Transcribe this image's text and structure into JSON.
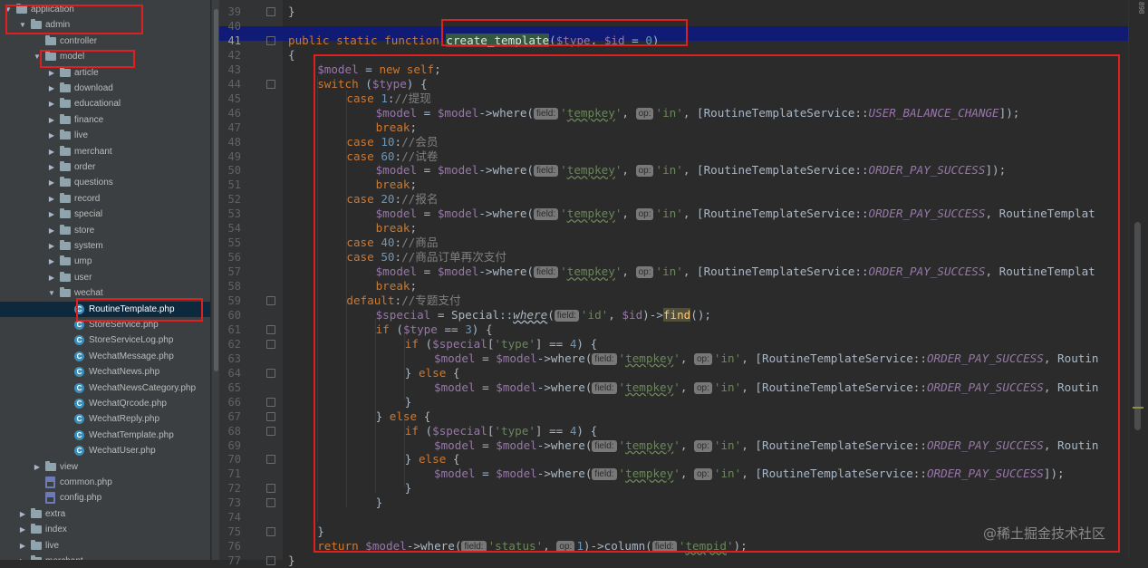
{
  "project_tree": {
    "items": [
      {
        "label": "application",
        "type": "folder",
        "depth": 0,
        "expanded": true
      },
      {
        "label": "admin",
        "type": "folder",
        "depth": 1,
        "expanded": true
      },
      {
        "label": "controller",
        "type": "folder",
        "depth": 2,
        "expanded": false,
        "no_arrow": true
      },
      {
        "label": "model",
        "type": "folder",
        "depth": 2,
        "expanded": true
      },
      {
        "label": "article",
        "type": "folder",
        "depth": 3,
        "expanded": false
      },
      {
        "label": "download",
        "type": "folder",
        "depth": 3,
        "expanded": false
      },
      {
        "label": "educational",
        "type": "folder",
        "depth": 3,
        "expanded": false
      },
      {
        "label": "finance",
        "type": "folder",
        "depth": 3,
        "expanded": false
      },
      {
        "label": "live",
        "type": "folder",
        "depth": 3,
        "expanded": false
      },
      {
        "label": "merchant",
        "type": "folder",
        "depth": 3,
        "expanded": false
      },
      {
        "label": "order",
        "type": "folder",
        "depth": 3,
        "expanded": false
      },
      {
        "label": "questions",
        "type": "folder",
        "depth": 3,
        "expanded": false
      },
      {
        "label": "record",
        "type": "folder",
        "depth": 3,
        "expanded": false
      },
      {
        "label": "special",
        "type": "folder",
        "depth": 3,
        "expanded": false
      },
      {
        "label": "store",
        "type": "folder",
        "depth": 3,
        "expanded": false
      },
      {
        "label": "system",
        "type": "folder",
        "depth": 3,
        "expanded": false
      },
      {
        "label": "ump",
        "type": "folder",
        "depth": 3,
        "expanded": false
      },
      {
        "label": "user",
        "type": "folder",
        "depth": 3,
        "expanded": false
      },
      {
        "label": "wechat",
        "type": "folder",
        "depth": 3,
        "expanded": true
      },
      {
        "label": "RoutineTemplate.php",
        "type": "class",
        "depth": 4,
        "selected": true
      },
      {
        "label": "StoreService.php",
        "type": "class",
        "depth": 4
      },
      {
        "label": "StoreServiceLog.php",
        "type": "class",
        "depth": 4
      },
      {
        "label": "WechatMessage.php",
        "type": "class",
        "depth": 4
      },
      {
        "label": "WechatNews.php",
        "type": "class",
        "depth": 4
      },
      {
        "label": "WechatNewsCategory.php",
        "type": "class",
        "depth": 4
      },
      {
        "label": "WechatQrcode.php",
        "type": "class",
        "depth": 4
      },
      {
        "label": "WechatReply.php",
        "type": "class",
        "depth": 4
      },
      {
        "label": "WechatTemplate.php",
        "type": "class",
        "depth": 4
      },
      {
        "label": "WechatUser.php",
        "type": "class",
        "depth": 4
      },
      {
        "label": "view",
        "type": "folder",
        "depth": 2,
        "expanded": false
      },
      {
        "label": "common.php",
        "type": "php",
        "depth": 2
      },
      {
        "label": "config.php",
        "type": "php",
        "depth": 2
      },
      {
        "label": "extra",
        "type": "folder",
        "depth": 1,
        "expanded": false
      },
      {
        "label": "index",
        "type": "folder",
        "depth": 1,
        "expanded": false
      },
      {
        "label": "live",
        "type": "folder",
        "depth": 1,
        "expanded": false
      },
      {
        "label": "merchant",
        "type": "folder",
        "depth": 1,
        "expanded": false
      }
    ]
  },
  "editor": {
    "current_line": 41,
    "lines": [
      {
        "n": 39,
        "indent": 0,
        "html": "}"
      },
      {
        "n": 40,
        "indent": 0,
        "html": ""
      },
      {
        "n": 41,
        "indent": 0,
        "html": "<span class=\"kw\">public static function </span><span class=\"hl\">create_template</span>(<span class=\"var\">$type</span>, <span class=\"var\">$id</span> = <span class=\"num\">0</span>)"
      },
      {
        "n": 42,
        "indent": 0,
        "html": "{"
      },
      {
        "n": 43,
        "indent": 1,
        "html": "<span class=\"var\">$model</span> = <span class=\"kw\">new self</span>;"
      },
      {
        "n": 44,
        "indent": 1,
        "html": "<span class=\"kw\">switch </span>(<span class=\"var\">$type</span>) {"
      },
      {
        "n": 45,
        "indent": 2,
        "html": "<span class=\"kw\">case </span><span class=\"num\">1</span>:<span class=\"cmt\">//提现</span>"
      },
      {
        "n": 46,
        "indent": 3,
        "html": "<span class=\"var\">$model</span> = <span class=\"var\">$model</span>-&gt;where(<span class=\"hint\">field:</span><span class=\"str\">'<span class=\"sq\">tempkey</span>'</span>, <span class=\"hint\">op:</span><span class=\"str\">'in'</span>, [RoutineTemplateService::<span class=\"cn\">USER_BALANCE_CHANGE</span>]);"
      },
      {
        "n": 47,
        "indent": 3,
        "html": "<span class=\"kw\">break</span>;"
      },
      {
        "n": 48,
        "indent": 2,
        "html": "<span class=\"kw\">case </span><span class=\"num\">10</span>:<span class=\"cmt\">//会员</span>"
      },
      {
        "n": 49,
        "indent": 2,
        "html": "<span class=\"kw\">case </span><span class=\"num\">60</span>:<span class=\"cmt\">//试卷</span>"
      },
      {
        "n": 50,
        "indent": 3,
        "html": "<span class=\"var\">$model</span> = <span class=\"var\">$model</span>-&gt;where(<span class=\"hint\">field:</span><span class=\"str\">'<span class=\"sq\">tempkey</span>'</span>, <span class=\"hint\">op:</span><span class=\"str\">'in'</span>, [RoutineTemplateService::<span class=\"cn\">ORDER_PAY_SUCCESS</span>]);"
      },
      {
        "n": 51,
        "indent": 3,
        "html": "<span class=\"kw\">break</span>;"
      },
      {
        "n": 52,
        "indent": 2,
        "html": "<span class=\"kw\">case </span><span class=\"num\">20</span>:<span class=\"cmt\">//报名</span>"
      },
      {
        "n": 53,
        "indent": 3,
        "html": "<span class=\"var\">$model</span> = <span class=\"var\">$model</span>-&gt;where(<span class=\"hint\">field:</span><span class=\"str\">'<span class=\"sq\">tempkey</span>'</span>, <span class=\"hint\">op:</span><span class=\"str\">'in'</span>, [RoutineTemplateService::<span class=\"cn\">ORDER_PAY_SUCCESS</span>, RoutineTemplat"
      },
      {
        "n": 54,
        "indent": 3,
        "html": "<span class=\"kw\">break</span>;"
      },
      {
        "n": 55,
        "indent": 2,
        "html": "<span class=\"kw\">case </span><span class=\"num\">40</span>:<span class=\"cmt\">//商品</span>"
      },
      {
        "n": 56,
        "indent": 2,
        "html": "<span class=\"kw\">case </span><span class=\"num\">50</span>:<span class=\"cmt\">//商品订单再次支付</span>"
      },
      {
        "n": 57,
        "indent": 3,
        "html": "<span class=\"var\">$model</span> = <span class=\"var\">$model</span>-&gt;where(<span class=\"hint\">field:</span><span class=\"str\">'<span class=\"sq\">tempkey</span>'</span>, <span class=\"hint\">op:</span><span class=\"str\">'in'</span>, [RoutineTemplateService::<span class=\"cn\">ORDER_PAY_SUCCESS</span>, RoutineTemplat"
      },
      {
        "n": 58,
        "indent": 3,
        "html": "<span class=\"kw\">break</span>;"
      },
      {
        "n": 59,
        "indent": 2,
        "html": "<span class=\"kw\">default</span>:<span class=\"cmt\">//专题支付</span>"
      },
      {
        "n": 60,
        "indent": 3,
        "html": "<span class=\"var\">$special</span> = Special::<span class=\"fn\" style=\"font-style:italic;color:#a9b7c6;text-decoration:underline wavy #a9b7c6;\">where</span>(<span class=\"hint\">field:</span><span class=\"str\">'id'</span>, <span class=\"var\">$id</span>)-&gt;<span class=\"findhl\">find</span>();"
      },
      {
        "n": 61,
        "indent": 3,
        "html": "<span class=\"kw\">if </span>(<span class=\"var\">$type</span> == <span class=\"num\">3</span>) {"
      },
      {
        "n": 62,
        "indent": 4,
        "html": "<span class=\"kw\">if </span>(<span class=\"var\">$special</span>[<span class=\"str\">'type'</span>] == <span class=\"num\">4</span>) {"
      },
      {
        "n": 63,
        "indent": 5,
        "html": "<span class=\"var\">$model</span> = <span class=\"var\">$model</span>-&gt;where(<span class=\"hint\">field:</span><span class=\"str\">'<span class=\"sq\">tempkey</span>'</span>, <span class=\"hint\">op:</span><span class=\"str\">'in'</span>, [RoutineTemplateService::<span class=\"cn\">ORDER_PAY_SUCCESS</span>, Routin"
      },
      {
        "n": 64,
        "indent": 4,
        "html": "} <span class=\"kw\">else </span>{"
      },
      {
        "n": 65,
        "indent": 5,
        "html": "<span class=\"var\">$model</span> = <span class=\"var\">$model</span>-&gt;where(<span class=\"hint\">field:</span><span class=\"str\">'<span class=\"sq\">tempkey</span>'</span>, <span class=\"hint\">op:</span><span class=\"str\">'in'</span>, [RoutineTemplateService::<span class=\"cn\">ORDER_PAY_SUCCESS</span>, Routin"
      },
      {
        "n": 66,
        "indent": 4,
        "html": "}"
      },
      {
        "n": 67,
        "indent": 3,
        "html": "} <span class=\"kw\">else </span>{"
      },
      {
        "n": 68,
        "indent": 4,
        "html": "<span class=\"kw\">if </span>(<span class=\"var\">$special</span>[<span class=\"str\">'type'</span>] == <span class=\"num\">4</span>) {"
      },
      {
        "n": 69,
        "indent": 5,
        "html": "<span class=\"var\">$model</span> = <span class=\"var\">$model</span>-&gt;where(<span class=\"hint\">field:</span><span class=\"str\">'<span class=\"sq\">tempkey</span>'</span>, <span class=\"hint\">op:</span><span class=\"str\">'in'</span>, [RoutineTemplateService::<span class=\"cn\">ORDER_PAY_SUCCESS</span>, Routin"
      },
      {
        "n": 70,
        "indent": 4,
        "html": "} <span class=\"kw\">else </span>{"
      },
      {
        "n": 71,
        "indent": 5,
        "html": "<span class=\"var\">$model</span> = <span class=\"var\">$model</span>-&gt;where(<span class=\"hint\">field:</span><span class=\"str\">'<span class=\"sq\">tempkey</span>'</span>, <span class=\"hint\">op:</span><span class=\"str\">'in'</span>, [RoutineTemplateService::<span class=\"cn\">ORDER_PAY_SUCCESS</span>]);"
      },
      {
        "n": 72,
        "indent": 4,
        "html": "}"
      },
      {
        "n": 73,
        "indent": 3,
        "html": "}"
      },
      {
        "n": 74,
        "indent": 0,
        "html": ""
      },
      {
        "n": 75,
        "indent": 1,
        "html": "}"
      },
      {
        "n": 76,
        "indent": 1,
        "html": "<span class=\"kw\">return </span><span class=\"var\">$model</span>-&gt;where(<span class=\"hint\">field:</span><span class=\"str\">'status'</span>, <span class=\"hint\">op:</span><span class=\"num\">1</span>)-&gt;column(<span class=\"hint\">field:</span><span class=\"str\">'<span class=\"sq\">tempid</span>'</span>);"
      },
      {
        "n": 77,
        "indent": 0,
        "html": "}"
      }
    ]
  },
  "watermark": "@稀土掘金技术社区",
  "inspection_label": "898"
}
